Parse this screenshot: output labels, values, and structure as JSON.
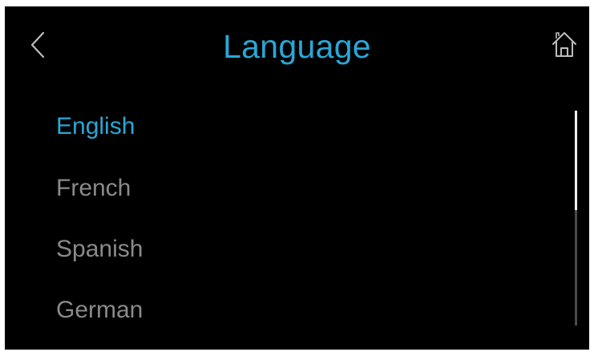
{
  "header": {
    "title": "Language",
    "back_icon": "chevron-left-icon",
    "home_icon": "home-icon"
  },
  "languages": [
    {
      "label": "English",
      "selected": true
    },
    {
      "label": "French",
      "selected": false
    },
    {
      "label": "Spanish",
      "selected": false
    },
    {
      "label": "German",
      "selected": false
    }
  ],
  "colors": {
    "accent": "#2aa7d6",
    "inactive_text": "#8a8a8a",
    "background": "#000000",
    "icon": "#bdbdbd"
  }
}
